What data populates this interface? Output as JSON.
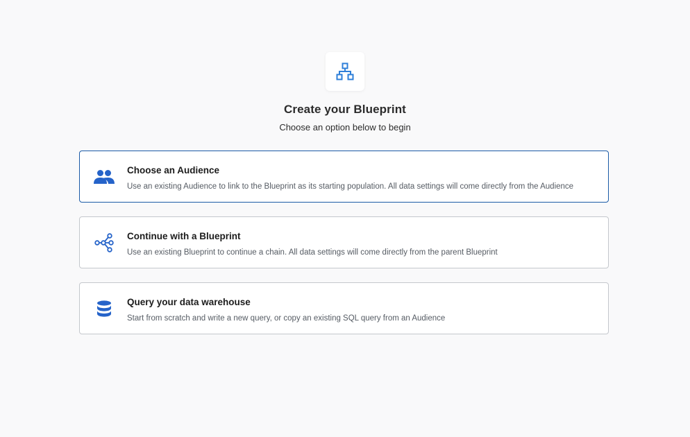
{
  "header": {
    "icon": "sitemap-icon",
    "title": "Create your Blueprint",
    "subtitle": "Choose an option below to begin"
  },
  "options": [
    {
      "icon": "people-icon",
      "title": "Choose an Audience",
      "description": "Use an existing Audience to link to the Blueprint as its starting population. All data settings will come directly from the Audience",
      "selected": true
    },
    {
      "icon": "share-nodes-icon",
      "title": "Continue with a Blueprint",
      "description": "Use an existing Blueprint to continue a chain. All data settings will come directly from the parent Blueprint",
      "selected": false
    },
    {
      "icon": "database-icon",
      "title": "Query your data warehouse",
      "description": "Start from scratch and write a new query, or copy an existing SQL query from an Audience",
      "selected": false
    }
  ],
  "colors": {
    "accent": "#2563c9",
    "selected_border": "#1a5aa6",
    "card_border": "#c4c7cc",
    "background": "#f9f9fa"
  }
}
